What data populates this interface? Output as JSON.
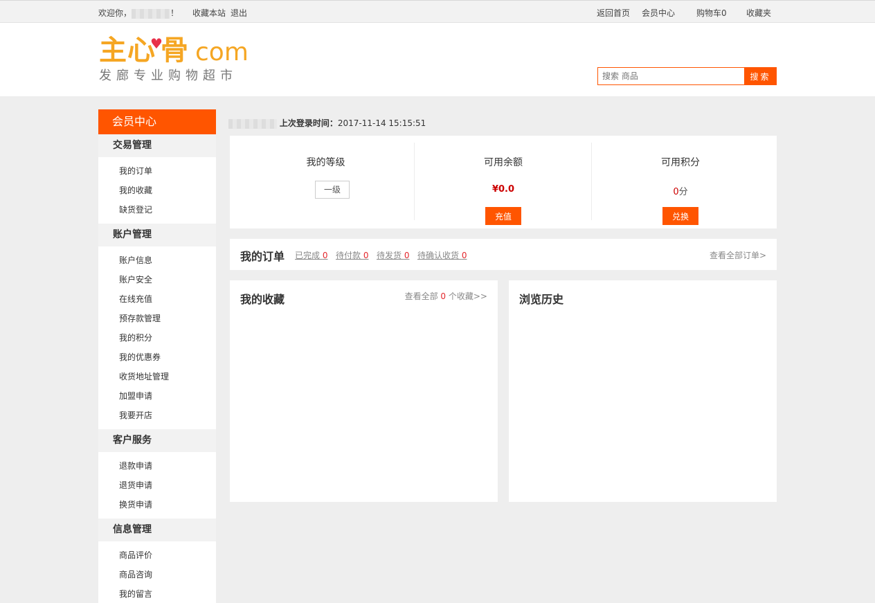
{
  "topbar": {
    "welcome": "欢迎你，",
    "exclaim": "！",
    "bookmark": "收藏本站",
    "logout": "退出",
    "home": "返回首页",
    "member_center": "会员中心",
    "cart_label": "购物车",
    "cart_count": "0",
    "favorites": "收藏夹"
  },
  "logo": {
    "main_a": "主",
    "main_b": "心",
    "heart": "♥",
    "main_c": "骨",
    "com": "com",
    "tagline": "发廊专业购物超市"
  },
  "search": {
    "placeholder": "搜索 商品",
    "button": "搜索"
  },
  "sidebar": {
    "title": "会员中心",
    "groups": [
      {
        "title": "交易管理",
        "items": [
          "我的订单",
          "我的收藏",
          "缺货登记"
        ]
      },
      {
        "title": "账户管理",
        "items": [
          "账户信息",
          "账户安全",
          "在线充值",
          "预存款管理",
          "我的积分",
          "我的优惠券",
          "收货地址管理",
          "加盟申请",
          "我要开店"
        ]
      },
      {
        "title": "客户服务",
        "items": [
          "退款申请",
          "退货申请",
          "换货申请"
        ]
      },
      {
        "title": "信息管理",
        "items": [
          "商品评价",
          "商品咨询",
          "我的留言"
        ]
      }
    ]
  },
  "user": {
    "last_login_label": "上次登录时间：",
    "last_login_time": "2017-11-14 15:15:51"
  },
  "stats": {
    "level_label": "我的等级",
    "level_value": "一级",
    "balance_label": "可用余额",
    "balance_value": "¥0.0",
    "recharge_button": "充值",
    "points_label": "可用积分",
    "points_value": "0",
    "points_unit": "分",
    "exchange_button": "兑换"
  },
  "orders": {
    "title": "我的订单",
    "completed_label": "已完成",
    "completed_count": "0",
    "unpaid_label": "待付款",
    "unpaid_count": "0",
    "unshipped_label": "待发货",
    "unshipped_count": "0",
    "unconfirmed_label": "待确认收货",
    "unconfirmed_count": "0",
    "view_all": "查看全部订单>"
  },
  "favorites": {
    "title": "我的收藏",
    "view_prefix": "查看全部",
    "count": "0",
    "view_suffix": "个收藏>>"
  },
  "history": {
    "title": "浏览历史"
  },
  "colors": {
    "accent": "#ff5500",
    "logo": "#f5a623",
    "count_red": "#e3272c"
  }
}
